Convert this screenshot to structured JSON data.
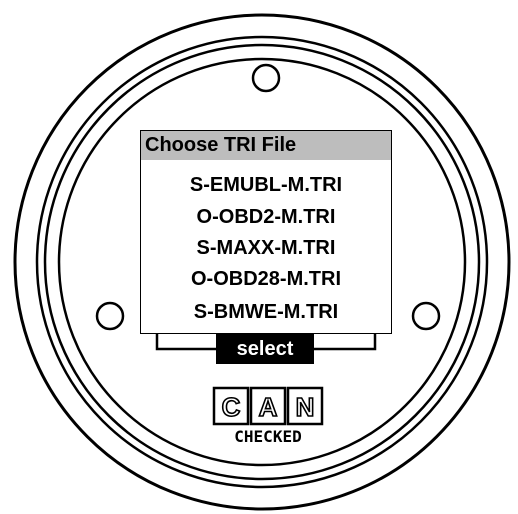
{
  "screen": {
    "title": "Choose TRI File",
    "files": [
      "S-EMUBL-M.TRI",
      "O-OBD2-M.TRI",
      "S-MAXX-M.TRI",
      "O-OBD28-M.TRI",
      "S-BMWE-M.TRI"
    ],
    "select_label": "select"
  },
  "logo": {
    "letters": [
      "C",
      "A",
      "N"
    ],
    "wordmark": "CHECKED"
  },
  "icons": {
    "up": "triangle-up-icon",
    "down": "triangle-down-icon"
  },
  "colors": {
    "header_bg": "#bdbdbd",
    "button_bg": "#000000",
    "button_text": "#ffffff"
  }
}
